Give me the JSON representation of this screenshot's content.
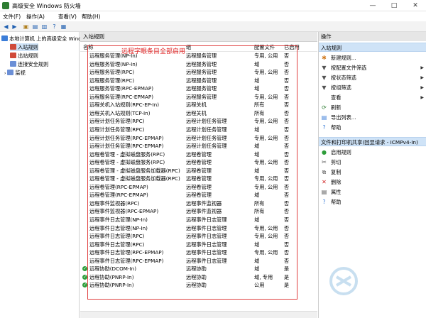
{
  "window": {
    "title": "高级安全 Windows 防火墙",
    "min": "—",
    "max": "□",
    "close": "✕"
  },
  "menu": [
    "文件(F)",
    "操作(A)",
    "查看(V)",
    "帮助(H)"
  ],
  "toolbar": [
    "◀",
    "▶",
    "▣",
    "▤",
    "▥",
    "?",
    "▦"
  ],
  "tree": [
    {
      "label": "本地计算机 上的高级安全 Windows",
      "color": "#3b7dd8"
    },
    {
      "label": "入站规则",
      "color": "#d04a3a"
    },
    {
      "label": "出站规则",
      "color": "#d04a3a"
    },
    {
      "label": "连接安全规则",
      "color": "#6b8fd6"
    },
    {
      "label": "监视",
      "color": "#6b8fd6"
    }
  ],
  "center": {
    "header": "入站规则",
    "columns": {
      "name": "名称",
      "group": "组",
      "profile": "配置文件",
      "enabled": "已启用"
    },
    "annotation": "远程字眼条目全部启用"
  },
  "rules": [
    {
      "name": "远程服务管理(NP-In)",
      "group": "远程服务管理",
      "profile": "专用, 公用",
      "enabled": "否",
      "check": false
    },
    {
      "name": "远程服务管理(NP-In)",
      "group": "远程服务管理",
      "profile": "域",
      "enabled": "否",
      "check": false
    },
    {
      "name": "远程服务管理(RPC)",
      "group": "远程服务管理",
      "profile": "专用, 公用",
      "enabled": "否",
      "check": false
    },
    {
      "name": "远程服务管理(RPC)",
      "group": "远程服务管理",
      "profile": "域",
      "enabled": "否",
      "check": false
    },
    {
      "name": "远程服务管理(RPC-EPMAP)",
      "group": "远程服务管理",
      "profile": "域",
      "enabled": "否",
      "check": false
    },
    {
      "name": "远程服务管理(RPC-EPMAP)",
      "group": "远程服务管理",
      "profile": "专用, 公用",
      "enabled": "否",
      "check": false
    },
    {
      "name": "远程关机入站规则(RPC-EP-In)",
      "group": "远程关机",
      "profile": "所有",
      "enabled": "否",
      "check": false
    },
    {
      "name": "远程关机入站规则(TCP-In)",
      "group": "远程关机",
      "profile": "所有",
      "enabled": "否",
      "check": false
    },
    {
      "name": "远程计划任务管理(RPC)",
      "group": "远程计划任务管理",
      "profile": "专用, 公用",
      "enabled": "否",
      "check": false
    },
    {
      "name": "远程计划任务管理(RPC)",
      "group": "远程计划任务管理",
      "profile": "域",
      "enabled": "否",
      "check": false
    },
    {
      "name": "远程计划任务管理(RPC-EPMAP)",
      "group": "远程计划任务管理",
      "profile": "专用, 公用",
      "enabled": "否",
      "check": false
    },
    {
      "name": "远程计划任务管理(RPC-EPMAP)",
      "group": "远程计划任务管理",
      "profile": "域",
      "enabled": "否",
      "check": false
    },
    {
      "name": "远程卷管理 - 虚拟磁盘服务(RPC)",
      "group": "远程卷管理",
      "profile": "域",
      "enabled": "否",
      "check": false
    },
    {
      "name": "远程卷管理 - 虚拟磁盘服务(RPC)",
      "group": "远程卷管理",
      "profile": "专用, 公用",
      "enabled": "否",
      "check": false
    },
    {
      "name": "远程卷管理 - 虚拟磁盘服务加载器(RPC)",
      "group": "远程卷管理",
      "profile": "域",
      "enabled": "否",
      "check": false
    },
    {
      "name": "远程卷管理 - 虚拟磁盘服务加载器(RPC)",
      "group": "远程卷管理",
      "profile": "专用, 公用",
      "enabled": "否",
      "check": false
    },
    {
      "name": "远程卷管理(RPC-EPMAP)",
      "group": "远程卷管理",
      "profile": "专用, 公用",
      "enabled": "否",
      "check": false
    },
    {
      "name": "远程卷管理(RPC-EPMAP)",
      "group": "远程卷管理",
      "profile": "域",
      "enabled": "否",
      "check": false
    },
    {
      "name": "远程事件监视器(RPC)",
      "group": "远程事件监视器",
      "profile": "所有",
      "enabled": "否",
      "check": false
    },
    {
      "name": "远程事件监视器(RPC-EPMAP)",
      "group": "远程事件监视器",
      "profile": "所有",
      "enabled": "否",
      "check": false
    },
    {
      "name": "远程事件日志管理(NP-In)",
      "group": "远程事件日志管理",
      "profile": "域",
      "enabled": "否",
      "check": false
    },
    {
      "name": "远程事件日志管理(NP-In)",
      "group": "远程事件日志管理",
      "profile": "专用, 公用",
      "enabled": "否",
      "check": false
    },
    {
      "name": "远程事件日志管理(RPC)",
      "group": "远程事件日志管理",
      "profile": "专用, 公用",
      "enabled": "否",
      "check": false
    },
    {
      "name": "远程事件日志管理(RPC)",
      "group": "远程事件日志管理",
      "profile": "域",
      "enabled": "否",
      "check": false
    },
    {
      "name": "远程事件日志管理(RPC-EPMAP)",
      "group": "远程事件日志管理",
      "profile": "专用, 公用",
      "enabled": "否",
      "check": false
    },
    {
      "name": "远程事件日志管理(RPC-EPMAP)",
      "group": "远程事件日志管理",
      "profile": "域",
      "enabled": "否",
      "check": false
    },
    {
      "name": "远程协助(DCOM-In)",
      "group": "远程协助",
      "profile": "域",
      "enabled": "是",
      "check": true
    },
    {
      "name": "远程协助(PNRP-In)",
      "group": "远程协助",
      "profile": "域, 专用",
      "enabled": "是",
      "check": true
    },
    {
      "name": "远程协助(PNRP-In)",
      "group": "远程协助",
      "profile": "公用",
      "enabled": "是",
      "check": true
    }
  ],
  "actions": {
    "section1": "操作",
    "sel1": "入站规则",
    "items1": [
      {
        "label": "新建规则...",
        "icon": "✱",
        "color": "#d07a20",
        "arrow": ""
      },
      {
        "label": "按配置文件筛选",
        "icon": "▼",
        "color": "#555",
        "arrow": "▶"
      },
      {
        "label": "按状态筛选",
        "icon": "▼",
        "color": "#555",
        "arrow": "▶"
      },
      {
        "label": "按组筛选",
        "icon": "▼",
        "color": "#555",
        "arrow": "▶"
      },
      {
        "label": "查看",
        "icon": "",
        "color": "#555",
        "arrow": "▶"
      },
      {
        "label": "刷新",
        "icon": "⟳",
        "color": "#2e7d32",
        "arrow": ""
      },
      {
        "label": "导出列表...",
        "icon": "▤",
        "color": "#3b7dd8",
        "arrow": ""
      },
      {
        "label": "帮助",
        "icon": "?",
        "color": "#3b7dd8",
        "arrow": ""
      }
    ],
    "sel2": "文件和打印机共享(回显请求 - ICMPv4-In)",
    "items2": [
      {
        "label": "启用规则",
        "icon": "●",
        "color": "#2e9d3a",
        "arrow": ""
      },
      {
        "label": "剪切",
        "icon": "✂",
        "color": "#555",
        "arrow": ""
      },
      {
        "label": "复制",
        "icon": "⧉",
        "color": "#555",
        "arrow": ""
      },
      {
        "label": "删除",
        "icon": "✕",
        "color": "#d02020",
        "arrow": ""
      },
      {
        "label": "属性",
        "icon": "▤",
        "color": "#555",
        "arrow": ""
      },
      {
        "label": "帮助",
        "icon": "?",
        "color": "#3b7dd8",
        "arrow": ""
      }
    ]
  }
}
